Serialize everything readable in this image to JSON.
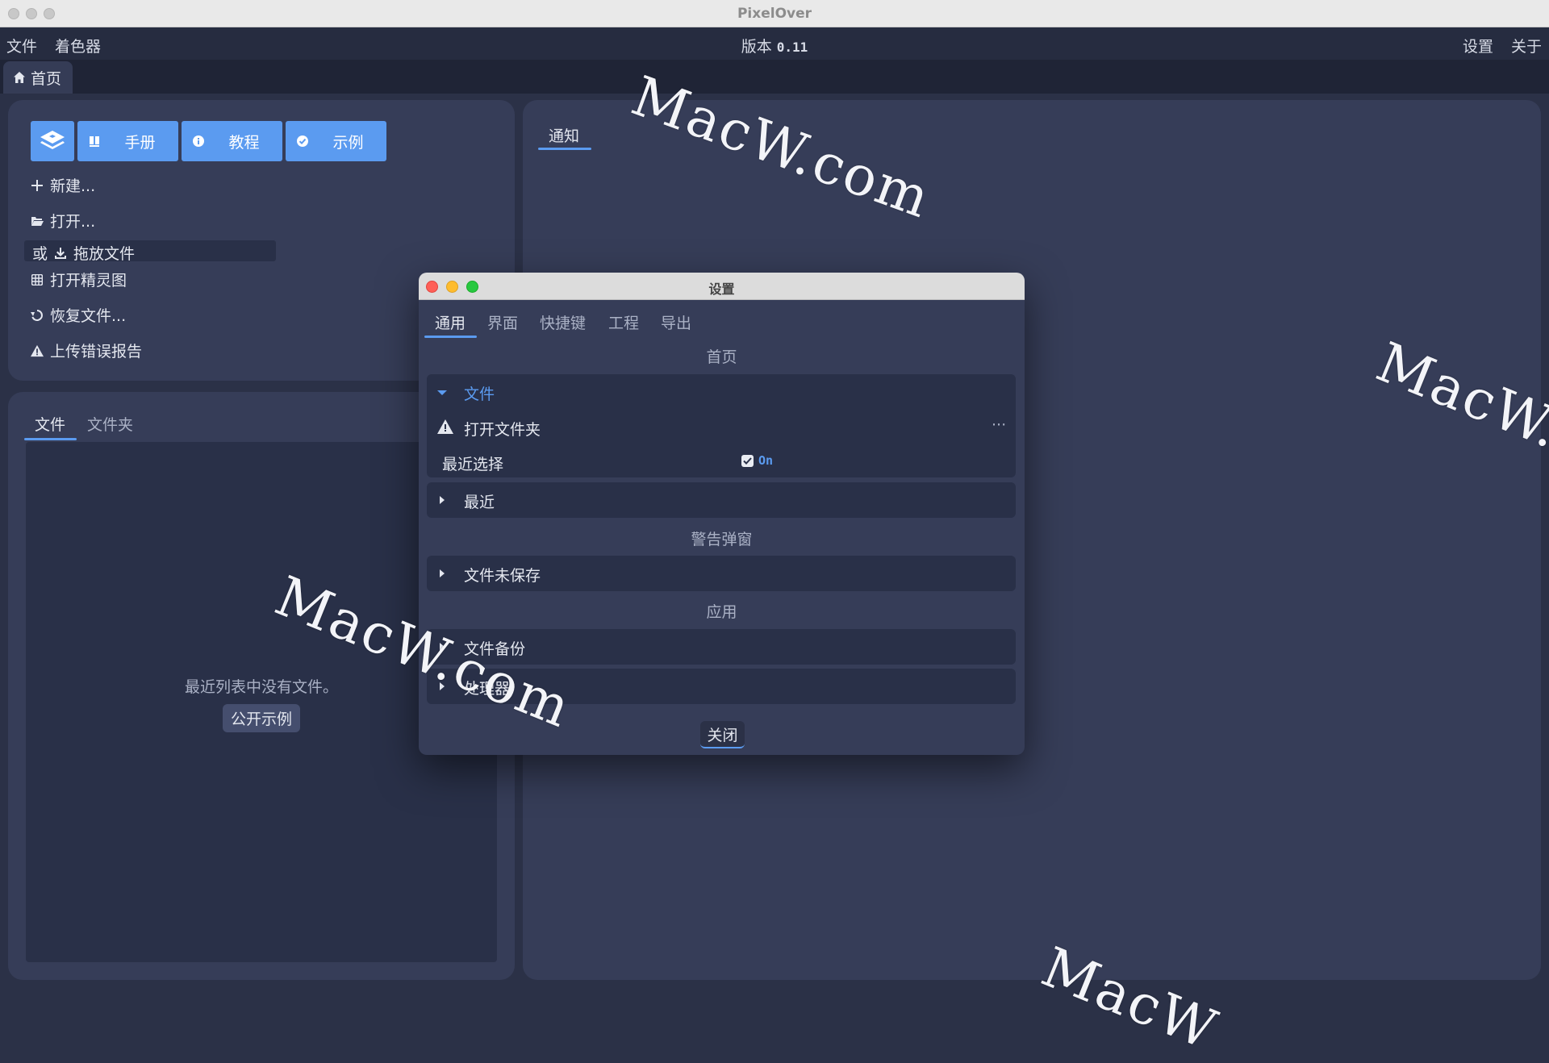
{
  "window": {
    "title": "PixelOver"
  },
  "menubar": {
    "left_items": [
      "文件",
      "着色器"
    ],
    "version_label": "版本",
    "version_number": "0.11",
    "right_items": [
      "设置",
      "关于"
    ]
  },
  "tabs": {
    "home_label": "首页"
  },
  "quick_buttons": [
    {
      "label": "手册",
      "icon": "book-icon"
    },
    {
      "label": "教程",
      "icon": "info-icon"
    },
    {
      "label": "示例",
      "icon": "check-circle-icon"
    }
  ],
  "start_actions": {
    "new": "新建...",
    "open": "打开...",
    "or": "或",
    "drop_files": "拖放文件",
    "open_spritesheet": "打开精灵图",
    "recover_files": "恢复文件...",
    "upload_error_report": "上传错误报告"
  },
  "files_panel": {
    "tabs": [
      "文件",
      "文件夹"
    ],
    "empty_message": "最近列表中没有文件。",
    "open_examples_button": "公开示例"
  },
  "notifications_panel": {
    "tab_label": "通知"
  },
  "settings_dialog": {
    "title": "设置",
    "tabs": [
      "通用",
      "界面",
      "快捷键",
      "工程",
      "导出"
    ],
    "sections": {
      "home": "首页",
      "warning_popups": "警告弹窗",
      "application": "应用"
    },
    "file_group": {
      "label": "文件",
      "open_folder_label": "打开文件夹",
      "more_button": "···",
      "recent_select_label": "最近选择",
      "recent_select_value": "On"
    },
    "recent_group": "最近",
    "unsaved_file_group": "文件未保存",
    "file_backup_group": "文件备份",
    "processor_group": "处理器",
    "close_button": "关闭"
  },
  "watermarks": [
    "MacW.com",
    "MacW.com",
    "MacW.co",
    "MacW"
  ],
  "colors": {
    "accent": "#5b9bf0",
    "background": "#2b3147",
    "panel": "#363d58",
    "card": "#293048"
  }
}
